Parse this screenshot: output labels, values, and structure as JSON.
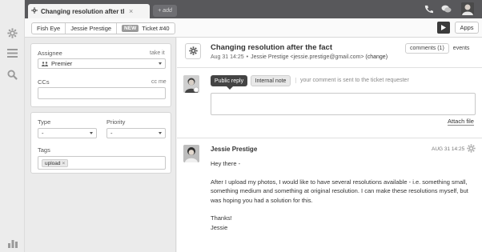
{
  "topbar": {
    "tab_title": "Changing resolution after th...",
    "tab_close": "×",
    "add_label": "+ add"
  },
  "breadcrumb": {
    "items": [
      "Fish Eye",
      "Jessie Prestige"
    ],
    "ticket_badge": "NEW",
    "ticket_label": "Ticket #40"
  },
  "toolbar": {
    "apps_label": "Apps"
  },
  "properties": {
    "assignee_label": "Assignee",
    "take_it": "take it",
    "assignee_value": "Premier",
    "ccs_label": "CCs",
    "cc_me": "cc me",
    "type_label": "Type",
    "type_value": "-",
    "priority_label": "Priority",
    "priority_value": "-",
    "tags_label": "Tags",
    "tag_value": "upload",
    "tag_remove": "×"
  },
  "ticket": {
    "subject": "Changing resolution after the fact",
    "date": "Aug 31 14:25",
    "requester": "Jessie Prestige <jessie.prestige@gmail.com>",
    "change": "(change)",
    "comments_tab": "comments (1)",
    "events_tab": "events"
  },
  "composer": {
    "public_reply": "Public reply",
    "internal_note": "Internal note",
    "hint": "your comment is sent to the ticket requester",
    "attach": "Attach file"
  },
  "comment": {
    "author": "Jessie Prestige",
    "time": "AUG 31 14:25",
    "greeting": "Hey there -",
    "paragraph": "After I upload my photos, I would like to have several resolutions available - i.e. something small, something medium and something at original resolution. I can make these resolutions myself, but was hoping you had a solution for this.",
    "signoff": "Thanks!",
    "signature": "Jessie"
  }
}
